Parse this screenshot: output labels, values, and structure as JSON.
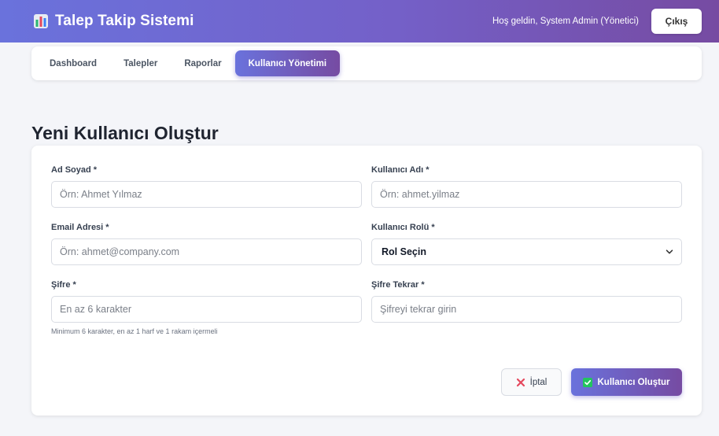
{
  "header": {
    "title": "Talep Takip Sistemi",
    "brand_icon": "bar-chart-icon",
    "welcome": "Hoş geldin, System Admin (Yönetici)",
    "logout_label": "Çıkış"
  },
  "nav": {
    "tabs": [
      {
        "label": "Dashboard",
        "active": false
      },
      {
        "label": "Talepler",
        "active": false
      },
      {
        "label": "Raporlar",
        "active": false
      },
      {
        "label": "Kullanıcı Yönetimi",
        "active": true
      }
    ]
  },
  "page": {
    "title": "Yeni Kullanıcı Oluştur"
  },
  "form": {
    "full_name": {
      "label": "Ad Soyad *",
      "placeholder": "Örn: Ahmet Yılmaz",
      "value": ""
    },
    "username": {
      "label": "Kullanıcı Adı *",
      "placeholder": "Örn: ahmet.yilmaz",
      "value": ""
    },
    "email": {
      "label": "Email Adresi *",
      "placeholder": "Örn: ahmet@company.com",
      "value": ""
    },
    "role": {
      "label": "Kullanıcı Rolü *",
      "selected": "Rol Seçin"
    },
    "password": {
      "label": "Şifre *",
      "placeholder": "En az 6 karakter",
      "value": "",
      "hint": "Minimum 6 karakter, en az 1 harf ve 1 rakam içermeli"
    },
    "password_confirm": {
      "label": "Şifre Tekrar *",
      "placeholder": "Şifreyi tekrar girin",
      "value": ""
    },
    "cancel_label": "İptal",
    "submit_label": "Kullanıcı Oluştur"
  },
  "colors": {
    "accent_start": "#6a72dc",
    "accent_end": "#764ba2",
    "cancel_icon": "#e5485d",
    "check_icon": "#22c55e"
  }
}
